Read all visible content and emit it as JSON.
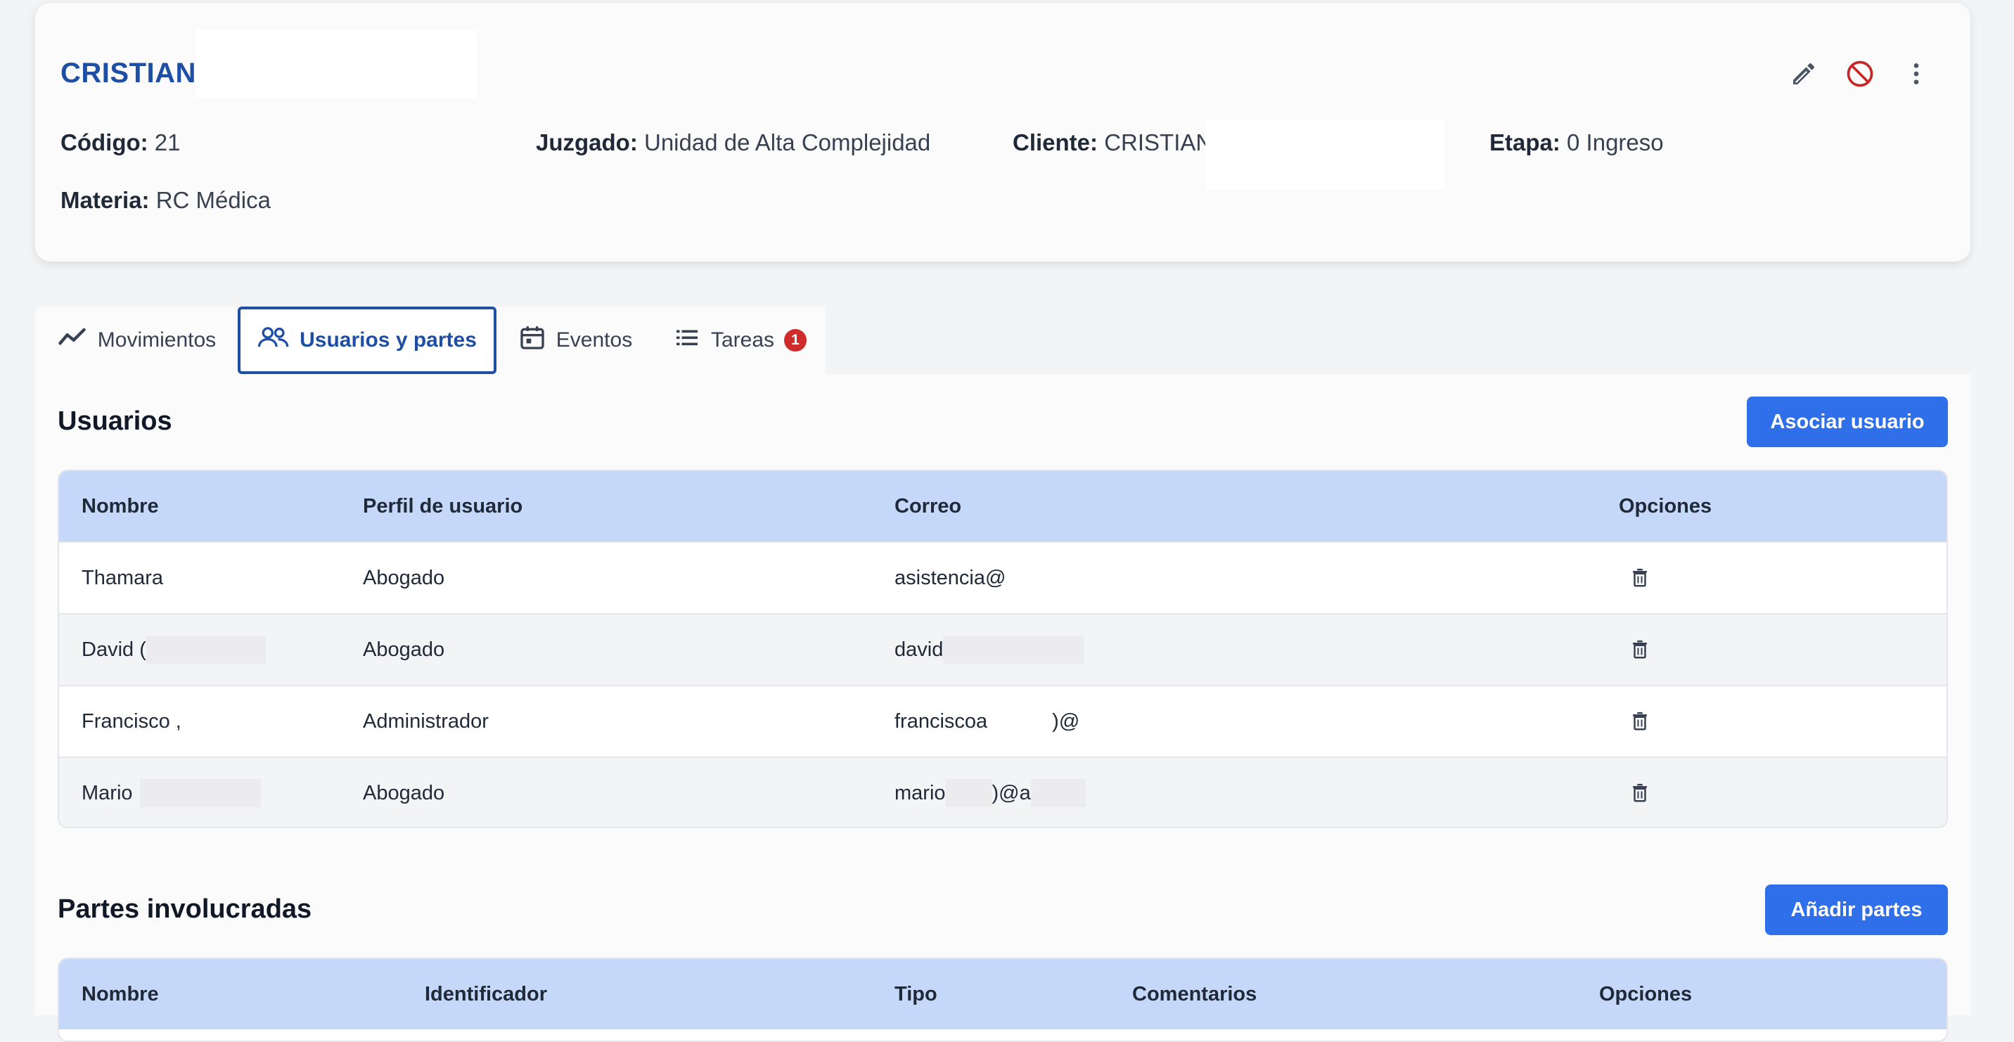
{
  "case": {
    "title": "CRISTIAN",
    "fields": {
      "codigo_label": "Código:",
      "codigo_value": "21",
      "juzgado_label": "Juzgado:",
      "juzgado_value": "Unidad de Alta Complejidad",
      "cliente_label": "Cliente:",
      "cliente_value": "CRISTIAN",
      "etapa_label": "Etapa:",
      "etapa_value": "0 Ingreso",
      "materia_label": "Materia:",
      "materia_value": "RC Médica"
    },
    "actions": [
      "edit-icon",
      "block-icon",
      "more-vert-icon"
    ]
  },
  "tabs": [
    {
      "label": "Movimientos",
      "icon": "trending-icon"
    },
    {
      "label": "Usuarios y partes",
      "icon": "users-icon",
      "active": true
    },
    {
      "label": "Eventos",
      "icon": "calendar-icon"
    },
    {
      "label": "Tareas",
      "icon": "list-icon",
      "badge": "1"
    }
  ],
  "usuarios": {
    "title": "Usuarios",
    "button": "Asociar usuario",
    "headers": [
      "Nombre",
      "Perfil de usuario",
      "Correo",
      "Opciones"
    ],
    "rows": [
      {
        "nombre": "Thamara",
        "perfil": "Abogado",
        "correo": "asistencia@"
      },
      {
        "nombre": "David (",
        "perfil": "Abogado",
        "correo": "david"
      },
      {
        "nombre": "Francisco ,",
        "perfil": "Administrador",
        "correo_a": "franciscoa",
        "correo_b": ")@"
      },
      {
        "nombre": "Mario",
        "perfil": "Abogado",
        "correo_a": "mario",
        "correo_b": ")@a"
      }
    ]
  },
  "partes": {
    "title": "Partes involucradas",
    "button": "Añadir partes",
    "headers": [
      "Nombre",
      "Identificador",
      "Tipo",
      "Comentarios",
      "Opciones"
    ]
  },
  "colors": {
    "accent": "#1e4fa5",
    "button": "#2f6fea",
    "table_header": "#c6d8fa",
    "badge": "#d02b2b"
  }
}
